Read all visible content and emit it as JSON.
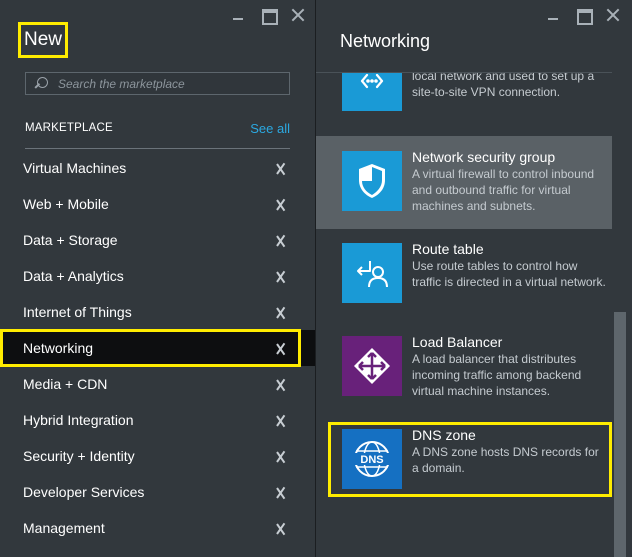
{
  "left_blade": {
    "title": "New",
    "search": {
      "placeholder": "Search the marketplace",
      "value": ""
    },
    "section_label": "MARKETPLACE",
    "see_all": "See all",
    "items": [
      {
        "label": "Virtual Machines"
      },
      {
        "label": "Web + Mobile"
      },
      {
        "label": "Data + Storage"
      },
      {
        "label": "Data + Analytics"
      },
      {
        "label": "Internet of Things"
      },
      {
        "label": "Networking",
        "selected": true
      },
      {
        "label": "Media + CDN"
      },
      {
        "label": "Hybrid Integration"
      },
      {
        "label": "Security + Identity"
      },
      {
        "label": "Developer Services"
      },
      {
        "label": "Management"
      }
    ]
  },
  "right_blade": {
    "title": "Networking",
    "items": [
      {
        "name": "",
        "description": "Represents the VPN device in your local network and used to set up a site-to-site VPN connection.",
        "icon": "vpn-device-icon",
        "tile_color": "#1a9ad6"
      },
      {
        "name": "Network security group",
        "description": "A virtual firewall to control inbound and outbound traffic for virtual machines and subnets.",
        "icon": "shield-icon",
        "tile_color": "#1a9ad6",
        "selected": true
      },
      {
        "name": "Route table",
        "description": "Use route tables to control how traffic is directed in a virtual network.",
        "icon": "route-table-icon",
        "tile_color": "#1a9ad6"
      },
      {
        "name": "Load Balancer",
        "description": "A load balancer that distributes incoming traffic among backend virtual machine instances.",
        "icon": "load-balancer-icon",
        "tile_color": "#68217a"
      },
      {
        "name": "DNS zone",
        "description": "A DNS zone hosts DNS records for a domain.",
        "icon": "dns-globe-icon",
        "tile_color": "#1570c2"
      }
    ]
  },
  "colors": {
    "blade_bg": "#32383d",
    "highlight": "#ffec00",
    "accent_link": "#2ba8e0",
    "selected_nav_bg": "#0d0e10",
    "selected_item_bg": "#5a6166"
  }
}
